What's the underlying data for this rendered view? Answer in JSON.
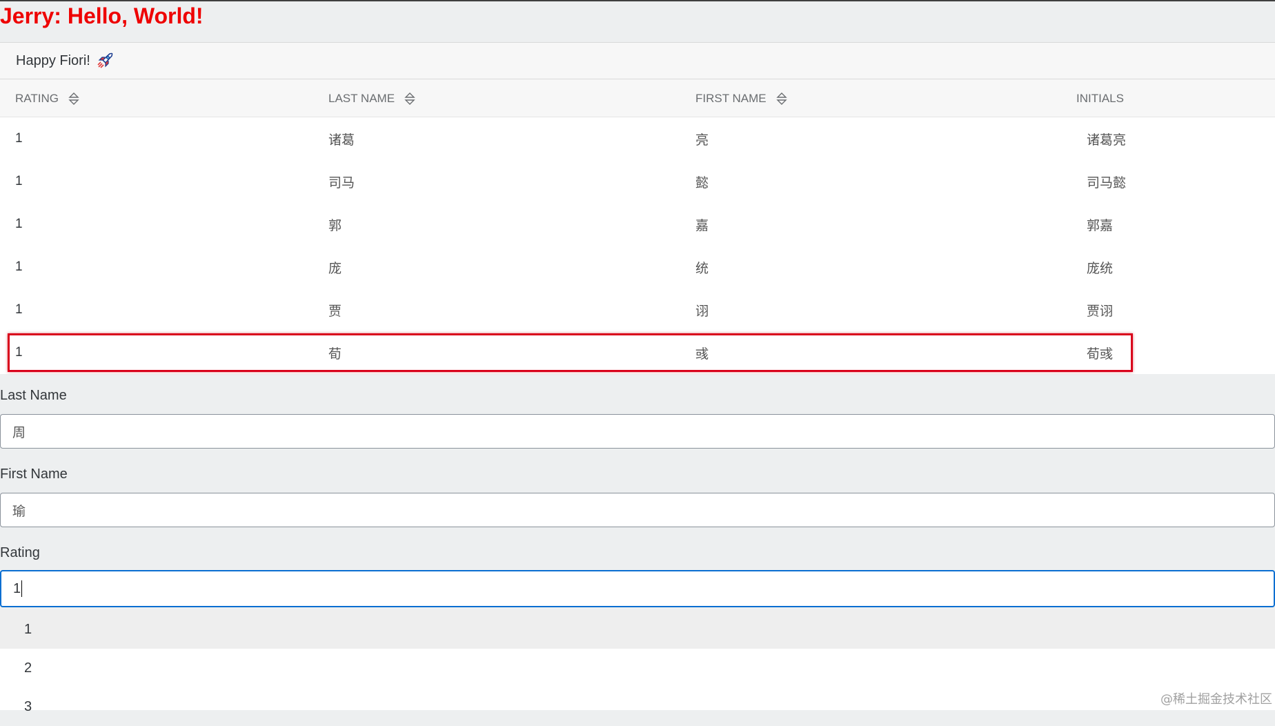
{
  "title": "Jerry: Hello, World!",
  "toolbar": {
    "title": "Happy Fiori!",
    "icon": "rocket-icon"
  },
  "table": {
    "columns": [
      "RATING",
      "LAST NAME",
      "FIRST NAME",
      "INITIALS"
    ],
    "rows": [
      {
        "rating": "1",
        "last": "诸葛",
        "first": "亮",
        "initials": "诸葛亮"
      },
      {
        "rating": "1",
        "last": "司马",
        "first": "懿",
        "initials": "司马懿"
      },
      {
        "rating": "1",
        "last": "郭",
        "first": "嘉",
        "initials": "郭嘉"
      },
      {
        "rating": "1",
        "last": "庞",
        "first": "统",
        "initials": "庞统"
      },
      {
        "rating": "1",
        "last": "贾",
        "first": "诩",
        "initials": "贾诩"
      },
      {
        "rating": "1",
        "last": "荀",
        "first": "彧",
        "initials": "荀彧"
      }
    ]
  },
  "form": {
    "last_name_label": "Last Name",
    "last_name_value": "周",
    "first_name_label": "First Name",
    "first_name_value": "瑜",
    "rating_label": "Rating",
    "rating_value": "1"
  },
  "suggestions": [
    "1",
    "2",
    "3"
  ],
  "watermark": "@稀土掘金技术社区",
  "colors": {
    "heading": "#ee0000",
    "highlight": "#d9001b",
    "focus": "#0a6ed1"
  }
}
